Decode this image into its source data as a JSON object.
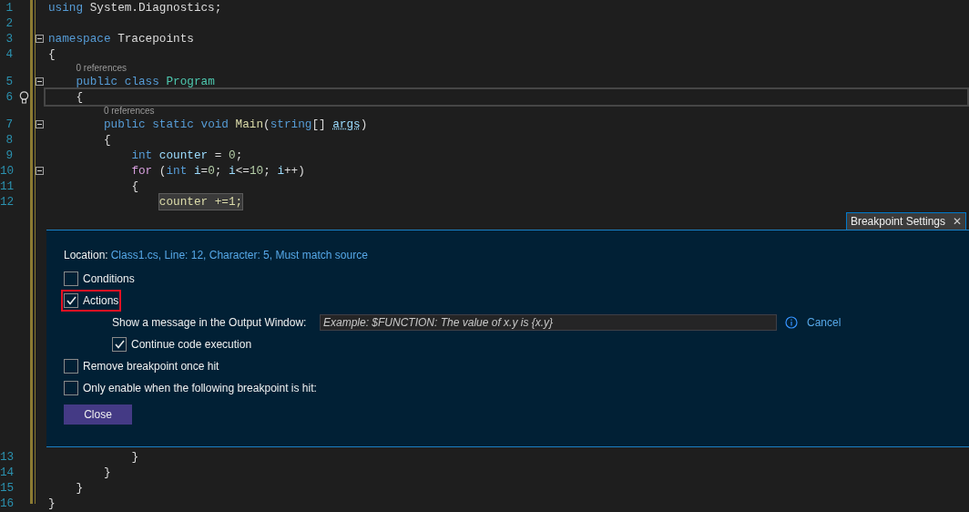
{
  "editor_top": [
    {
      "number": "1",
      "fold": false,
      "tokens": [
        {
          "text": "using ",
          "kind": "keyword"
        },
        {
          "text": "System.Diagnostics;",
          "kind": "plain"
        }
      ]
    },
    {
      "number": "2",
      "fold": false
    },
    {
      "number": "3",
      "fold": true,
      "tokens": [
        {
          "text": "namespace ",
          "kind": "keyword"
        },
        {
          "text": "Tracepoints",
          "kind": "plain"
        }
      ]
    },
    {
      "number": "4",
      "fold": false,
      "tokens": [
        {
          "text": "{",
          "kind": "plain"
        }
      ]
    },
    {
      "number": "5",
      "fold": true,
      "codelens": "0 references",
      "tokens": [
        {
          "text": "    public ",
          "kind": "keyword"
        },
        {
          "text": "class ",
          "kind": "keyword"
        },
        {
          "text": "Program",
          "kind": "type"
        }
      ]
    },
    {
      "number": "6",
      "fold": false,
      "current": true,
      "lightbulb": true,
      "tokens": [
        {
          "text": "    {",
          "kind": "plain"
        }
      ]
    },
    {
      "number": "7",
      "fold": true,
      "codelens": "0 references",
      "tokens": [
        {
          "text": "        public ",
          "kind": "keyword"
        },
        {
          "text": "static ",
          "kind": "keyword"
        },
        {
          "text": "void ",
          "kind": "keyword"
        },
        {
          "text": "Main",
          "kind": "method"
        },
        {
          "text": "(",
          "kind": "plain"
        },
        {
          "text": "string",
          "kind": "keyword"
        },
        {
          "text": "[] ",
          "kind": "plain"
        },
        {
          "text": "args",
          "kind": "variable_dotted"
        },
        {
          "text": ")",
          "kind": "plain"
        }
      ]
    },
    {
      "number": "8",
      "fold": false,
      "tokens": [
        {
          "text": "        {",
          "kind": "plain"
        }
      ]
    },
    {
      "number": "9",
      "fold": false,
      "tokens": [
        {
          "text": "            int ",
          "kind": "keyword"
        },
        {
          "text": "counter",
          "kind": "variable"
        },
        {
          "text": " = ",
          "kind": "plain"
        },
        {
          "text": "0",
          "kind": "number"
        },
        {
          "text": ";",
          "kind": "plain"
        }
      ]
    },
    {
      "number": "10",
      "fold": true,
      "tokens": [
        {
          "text": "            for",
          "kind": "control"
        },
        {
          "text": " (",
          "kind": "plain"
        },
        {
          "text": "int ",
          "kind": "keyword"
        },
        {
          "text": "i",
          "kind": "variable"
        },
        {
          "text": "=",
          "kind": "plain"
        },
        {
          "text": "0",
          "kind": "number"
        },
        {
          "text": "; ",
          "kind": "plain"
        },
        {
          "text": "i",
          "kind": "variable"
        },
        {
          "text": "<=",
          "kind": "plain"
        },
        {
          "text": "10",
          "kind": "number"
        },
        {
          "text": "; ",
          "kind": "plain"
        },
        {
          "text": "i",
          "kind": "variable"
        },
        {
          "text": "++)",
          "kind": "plain"
        }
      ]
    },
    {
      "number": "11",
      "fold": false,
      "tokens": [
        {
          "text": "            {",
          "kind": "plain"
        }
      ]
    },
    {
      "number": "12",
      "fold": false,
      "tokens": [
        {
          "text": "                counter +=1;",
          "kind": "tracepoint"
        }
      ]
    }
  ],
  "settings": {
    "tab": {
      "title": "Breakpoint Settings",
      "close": "✕"
    },
    "location_label": "Location:",
    "location_value": "Class1.cs, Line: 12, Character: 5, Must match source",
    "options": [
      {
        "kind": "check",
        "label": "Conditions",
        "checked": false,
        "highlighted": false
      },
      {
        "kind": "check",
        "label": "Actions",
        "checked": true,
        "highlighted": true
      },
      {
        "kind": "message",
        "label": "Show a message in the Output Window:",
        "placeholder": "Example: $FUNCTION: The value of x.y is {x.y}",
        "cancel": "Cancel"
      },
      {
        "kind": "subcheck",
        "label": "Continue code execution",
        "checked": true,
        "highlighted": false
      },
      {
        "kind": "check",
        "label": "Remove breakpoint once hit",
        "checked": false,
        "highlighted": false
      },
      {
        "kind": "check",
        "label": "Only enable when the following breakpoint is hit:",
        "checked": false,
        "highlighted": false
      }
    ],
    "close_button": "Close"
  },
  "editor_bottom": [
    {
      "number": "13",
      "fold": false,
      "tokens": [
        {
          "text": "            }",
          "kind": "plain"
        }
      ]
    },
    {
      "number": "14",
      "fold": false,
      "tokens": [
        {
          "text": "        }",
          "kind": "plain"
        }
      ]
    },
    {
      "number": "15",
      "fold": false,
      "tokens": [
        {
          "text": "    }",
          "kind": "plain"
        }
      ]
    },
    {
      "number": "16",
      "fold": false,
      "tokens": [
        {
          "text": "}",
          "kind": "plain"
        }
      ]
    }
  ]
}
